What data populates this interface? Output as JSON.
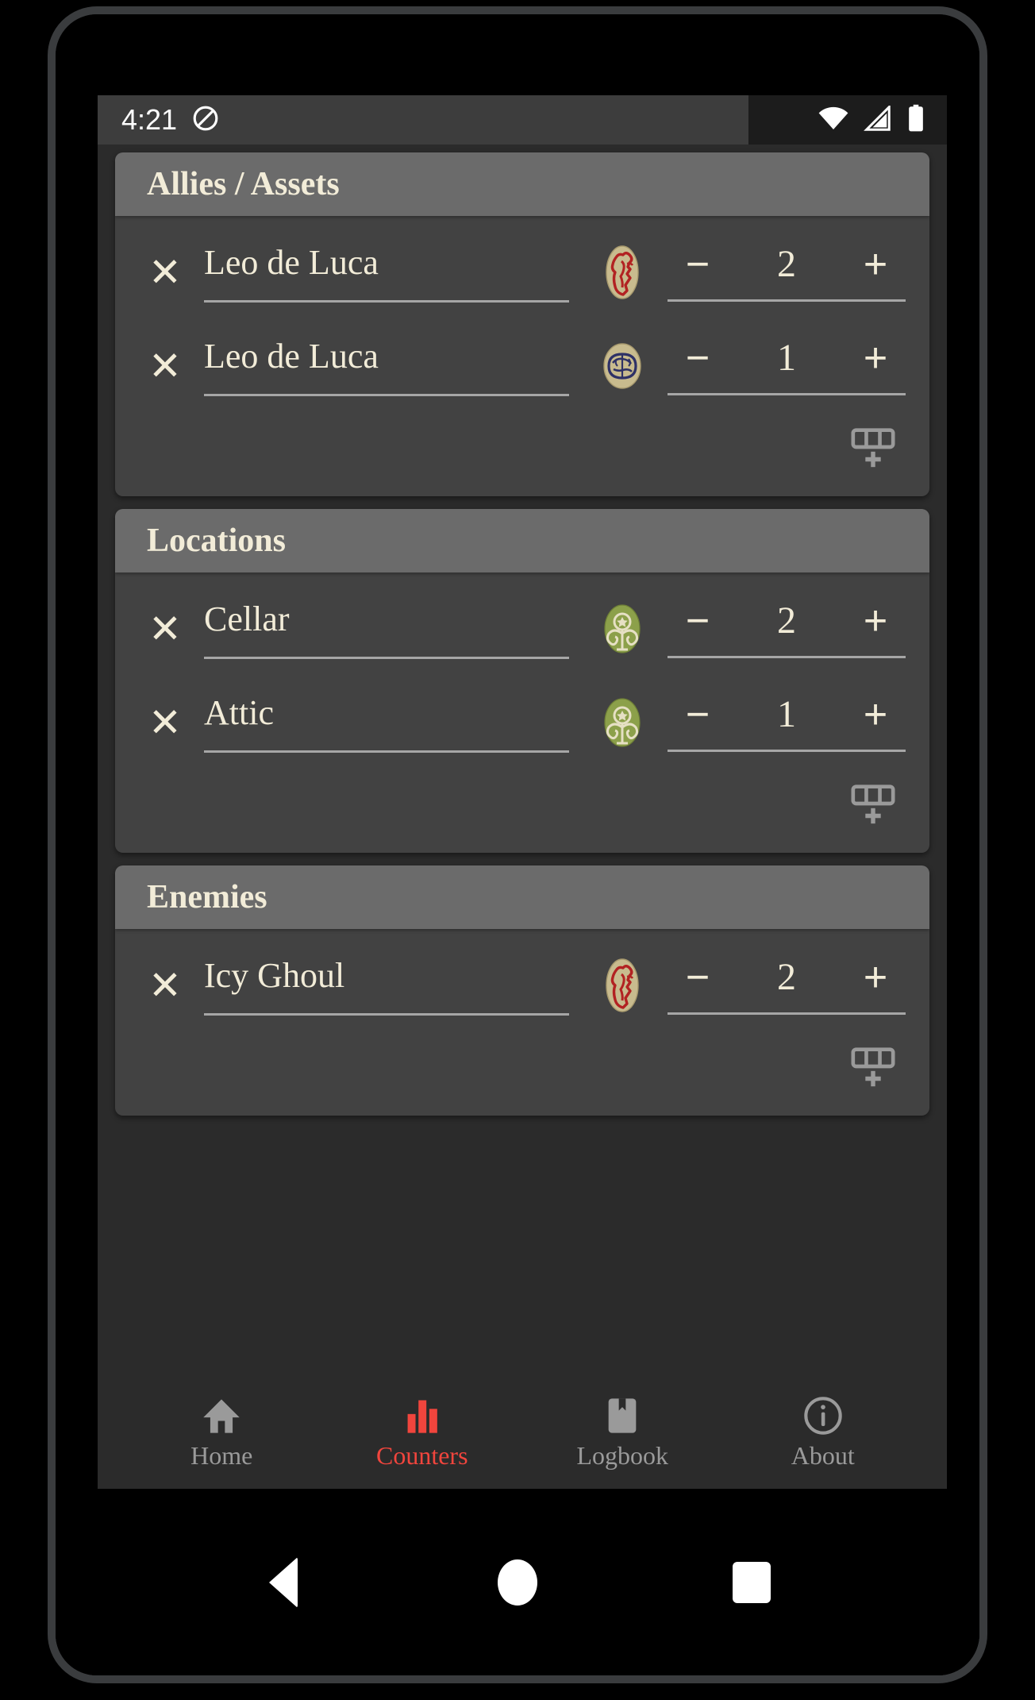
{
  "status_bar": {
    "time": "4:21",
    "icons": [
      "do-not-disturb-icon",
      "wifi-icon",
      "cellular-signal-icon",
      "battery-icon"
    ]
  },
  "colors": {
    "card_background": "#424242",
    "card_header_background": "#6b6b6b",
    "app_background": "#2b2b2b",
    "text_cream": "#f2ecd8",
    "underline_gray": "#a6a6a6",
    "accent_red": "#f1453d",
    "nav_inactive_gray": "#9a9a9a",
    "token_health_red": "#b22222",
    "token_sanity_blue": "#2e3166",
    "token_clue_green": "#8ca04a",
    "token_parchment": "#c8bb8e"
  },
  "cards": [
    {
      "title": "Allies / Assets",
      "add_row_label": "add-row",
      "rows": [
        {
          "delete_label": "✕",
          "name": "Leo de Luca",
          "token": "health-token",
          "decrement_label": "−",
          "value": "2",
          "increment_label": "+"
        },
        {
          "delete_label": "✕",
          "name": "Leo de Luca",
          "token": "sanity-token",
          "decrement_label": "−",
          "value": "1",
          "increment_label": "+"
        }
      ]
    },
    {
      "title": "Locations",
      "add_row_label": "add-row",
      "rows": [
        {
          "delete_label": "✕",
          "name": "Cellar",
          "token": "clue-token",
          "decrement_label": "−",
          "value": "2",
          "increment_label": "+"
        },
        {
          "delete_label": "✕",
          "name": "Attic",
          "token": "clue-token",
          "decrement_label": "−",
          "value": "1",
          "increment_label": "+"
        }
      ]
    },
    {
      "title": "Enemies",
      "add_row_label": "add-row",
      "rows": [
        {
          "delete_label": "✕",
          "name": "Icy Ghoul",
          "token": "health-token",
          "decrement_label": "−",
          "value": "2",
          "increment_label": "+"
        }
      ]
    }
  ],
  "bottom_nav": {
    "items": [
      {
        "label": "Home",
        "icon": "home-icon",
        "active": false
      },
      {
        "label": "Counters",
        "icon": "bar-chart-icon",
        "active": true
      },
      {
        "label": "Logbook",
        "icon": "bookmark-icon",
        "active": false
      },
      {
        "label": "About",
        "icon": "info-circle-icon",
        "active": false
      }
    ]
  },
  "system_nav": {
    "back": "back-button",
    "home": "home-button",
    "recents": "recents-button"
  }
}
